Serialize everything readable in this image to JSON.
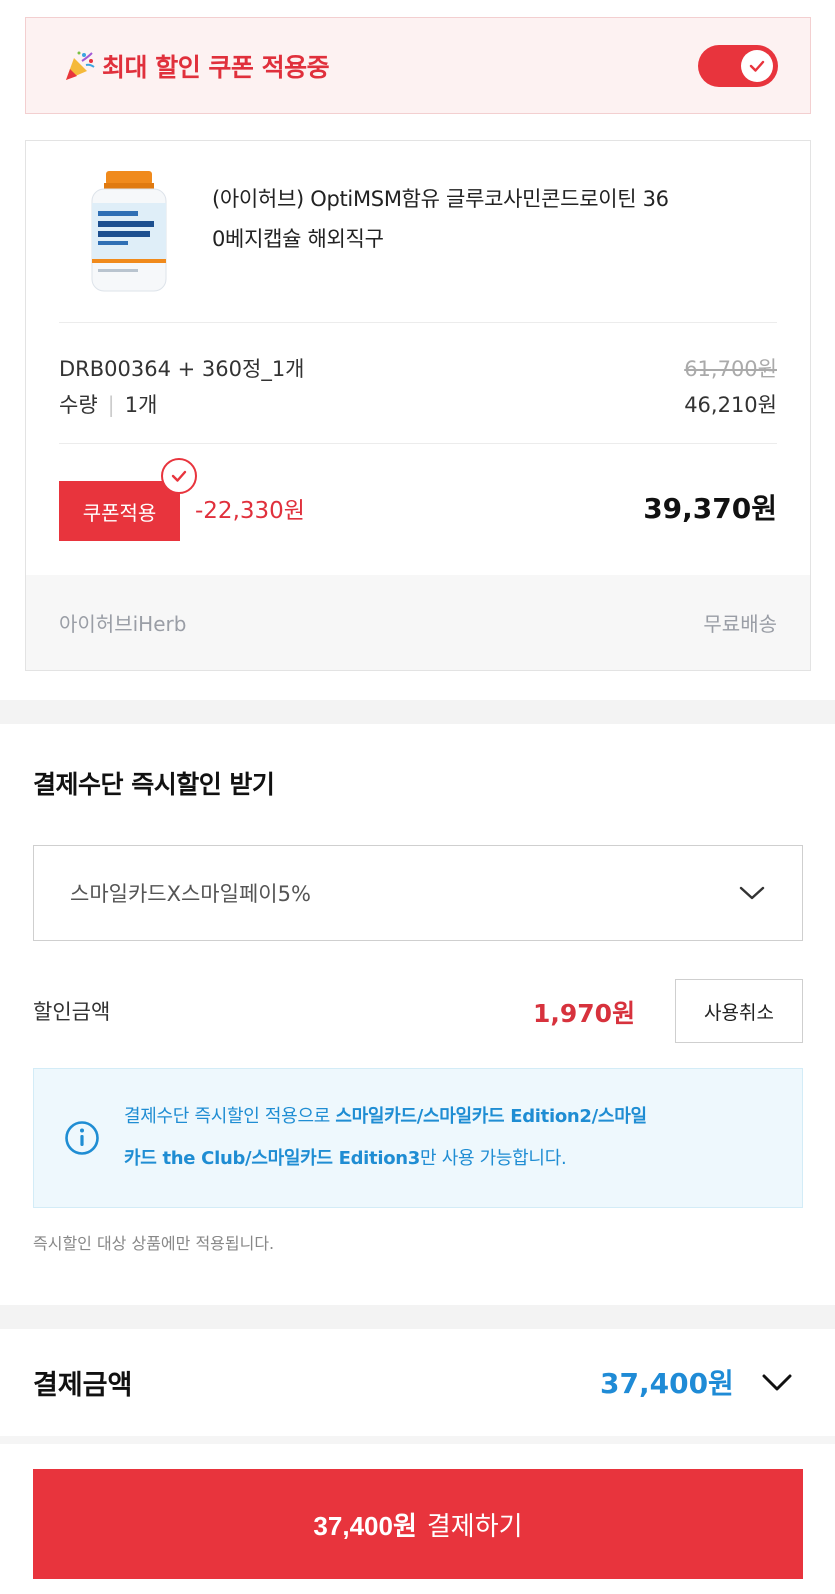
{
  "coupon_banner": {
    "label": "최대 할인 쿠폰 적용중",
    "toggle_on": true,
    "accent_color": "#e8343d"
  },
  "product": {
    "name": "(아이허브) OptiMSM함유 글루코사민콘드로이틴 360베지캡슐 해외직구",
    "name_line1": "(아이허브) OptiMSM함유 글루코사민콘드로이틴 36",
    "name_line2": "0베지캡슐 해외직구",
    "option": "DRB00364 + 360정_1개",
    "qty_label": "수량",
    "qty_value": "1개",
    "original_price": "61,700원",
    "sale_price": "46,210원",
    "coupon_button": "쿠폰적용",
    "coupon_discount": "-22,330원",
    "final_price": "39,370원",
    "seller": "아이허브iHerb",
    "shipping": "무료배송"
  },
  "payment_discount": {
    "title": "결제수단 즉시할인 받기",
    "selected_option": "스마일카드X스마일페이5%",
    "discount_label": "할인금액",
    "discount_amount": "1,970원",
    "cancel_button": "사용취소",
    "info_prefix": "결제수단 즉시할인 적용으로 ",
    "info_bold": "스마일카드/스마일카드 Edition2/스마일카드 the Club/스마일카드 Edition3",
    "info_suffix": "만 사용 가능합니다.",
    "info_line1_prefix": "결제수단 즉시할인 적용으로 ",
    "info_line1_bold": "스마일카드/스마일카드 Edition2/스마일",
    "info_line2_bold": "카드 the Club/스마일카드 Edition3",
    "info_line2_suffix": "만 사용 가능합니다.",
    "note": "즉시할인 대상 상품에만 적용됩니다."
  },
  "payment_total": {
    "label": "결제금액",
    "amount": "37,400원"
  },
  "pay_button": {
    "amount": "37,400원",
    "label": "결제하기"
  },
  "icons": {
    "banner": "party-popper-icon",
    "toggle_check": "check-icon",
    "select": "chevron-down-icon",
    "info": "info-icon"
  }
}
